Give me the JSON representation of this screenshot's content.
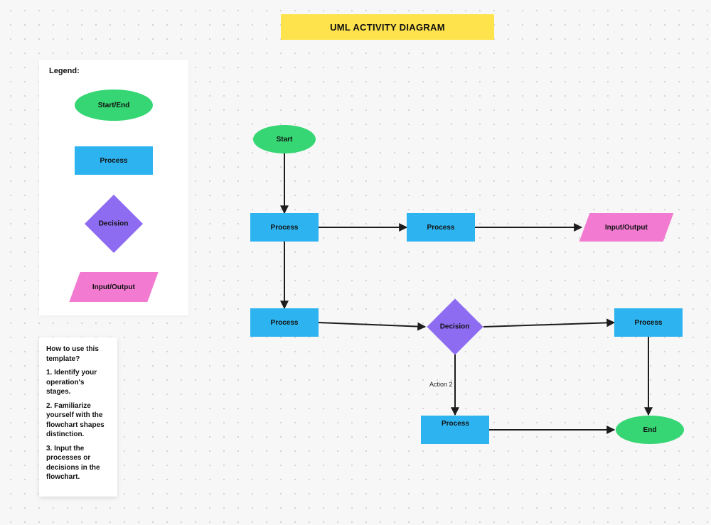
{
  "title": "UML ACTIVITY DIAGRAM",
  "legend": {
    "heading": "Legend:",
    "items": {
      "start_end": "Start/End",
      "process": "Process",
      "decision": "Decision",
      "io": "Input/Output"
    }
  },
  "help": {
    "heading": "How to use this template?",
    "steps": [
      "1. Identify your operation's stages.",
      "2. Familiarize yourself with the flowchart shapes distinction.",
      "3. Input the processes or decisions in the flowchart."
    ]
  },
  "nodes": {
    "start": "Start",
    "process1": "Process",
    "process2": "Process",
    "io1": "Input/Output",
    "process3": "Process",
    "decision": "Decision",
    "process4": "Process",
    "process5": "Process",
    "end": "End"
  },
  "edges": {
    "decision_down_label": "Action 2"
  }
}
